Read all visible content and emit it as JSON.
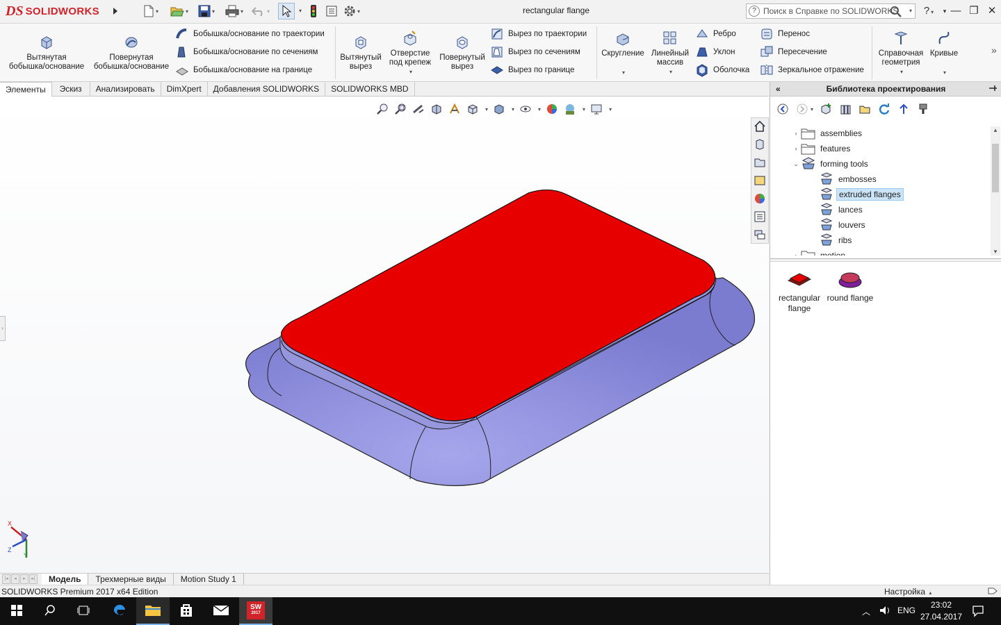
{
  "app": {
    "logo_ds": "DS",
    "logo_text": "SOLIDWORKS",
    "document_title": "rectangular flange",
    "help_search_placeholder": "Поиск в Справке по SOLIDWORKS"
  },
  "quick_access": [
    "new-icon",
    "open-icon",
    "save-icon",
    "print-icon",
    "undo-icon",
    "select-icon",
    "rebuild-icon",
    "file-properties-icon",
    "options-icon"
  ],
  "commands": {
    "extruded_boss": "Вытянутая\nбобышка/основание",
    "revolved_boss": "Повернутая\nбобышка/основание",
    "swept_boss": "Бобышка/основание по траектории",
    "lofted_boss": "Бобышка/основание по сечениям",
    "boundary_boss": "Бобышка/основание на границе",
    "extruded_cut": "Вытянутый\nвырез",
    "hole_wizard": "Отверстие\nпод крепеж",
    "revolved_cut": "Повернутый\nвырез",
    "swept_cut": "Вырез по траектории",
    "lofted_cut": "Вырез по сечениям",
    "boundary_cut": "Вырез по границе",
    "fillet": "Скругление",
    "linear_pattern": "Линейный\nмассив",
    "rib": "Ребро",
    "draft": "Уклон",
    "shell": "Оболочка",
    "wrap": "Перенос",
    "intersect": "Пересечение",
    "mirror": "Зеркальное отражение",
    "reference_geometry": "Справочная\nгеометрия",
    "curves": "Кривые",
    "more": "»"
  },
  "tabs": [
    "Элементы",
    "Эскиз",
    "Анализировать",
    "DimXpert",
    "Добавления SOLIDWORKS",
    "SOLIDWORKS MBD"
  ],
  "bottom_tabs": [
    "Модель",
    "Трехмерные виды",
    "Motion Study 1"
  ],
  "status": {
    "edition": "SOLIDWORKS Premium 2017 x64 Edition",
    "customize": "Настройка"
  },
  "task_pane": {
    "title": "Библиотека проектирования",
    "tree": [
      {
        "label": "assemblies",
        "expanded": false,
        "depth": 0
      },
      {
        "label": "features",
        "expanded": false,
        "depth": 0
      },
      {
        "label": "forming tools",
        "expanded": true,
        "depth": 0
      },
      {
        "label": "embosses",
        "depth": 1
      },
      {
        "label": "extruded flanges",
        "depth": 1,
        "selected": true
      },
      {
        "label": "lances",
        "depth": 1
      },
      {
        "label": "louvers",
        "depth": 1
      },
      {
        "label": "ribs",
        "depth": 1
      },
      {
        "label": "motion",
        "depth": 0
      }
    ],
    "items": [
      {
        "label": "rectangular\nflange",
        "color": "#d22020"
      },
      {
        "label": "round flange",
        "color": "#8b2a9e"
      }
    ]
  },
  "colors": {
    "logo_red": "#d1232a",
    "model_top": "#e60000",
    "model_flange": "#8585d6",
    "selection": "#cce4f7"
  },
  "taskbar": {
    "time": "23:02",
    "date": "27.04.2017",
    "language": "ENG",
    "sw_badge": "2017",
    "apps": [
      "start-icon",
      "search-icon",
      "task-view-icon",
      "edge-icon",
      "file-explorer-icon",
      "store-icon",
      "mail-icon",
      "solidworks-icon"
    ]
  }
}
